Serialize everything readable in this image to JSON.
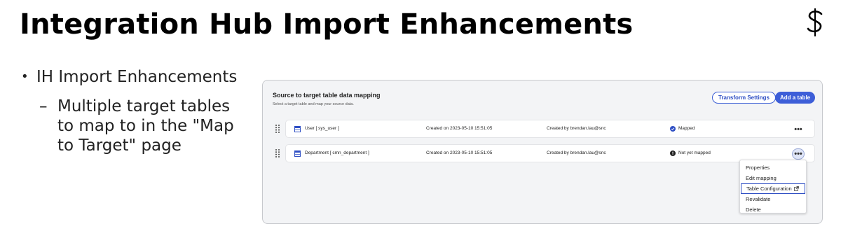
{
  "slide": {
    "title": "Integration Hub Import Enhancements",
    "logo_icon": "servicenow-dollar-logo",
    "bullet_1": "IH Import Enhancements",
    "bullet_2": "Multiple target tables to map to in the \"Map to Target\" page",
    "dash": "–",
    "dot": "•"
  },
  "panel": {
    "title": "Source to target table data mapping",
    "subtitle": "Select a target table and map your source data.",
    "transform_label": "Transform Settings",
    "add_label": "Add a table",
    "accent_color": "#3d5ed8"
  },
  "rows": [
    {
      "name": "User [ sys_user ]",
      "created": "Created on 2023-05-10 15:51:05",
      "by": "Created by brendan.lau@snc",
      "status": "Mapped",
      "status_icon": "check-circle-icon",
      "more": "•••"
    },
    {
      "name": "Department [ cmn_department ]",
      "created": "Created on 2023-05-10 15:51:05",
      "by": "Created by brendan.lau@snc",
      "status": "Not yet mapped",
      "status_icon": "alert-circle-icon",
      "more": "•••"
    }
  ],
  "menu": {
    "items": [
      "Properties",
      "Edit mapping",
      "Table Configuration",
      "Revalidate",
      "Delete"
    ]
  }
}
